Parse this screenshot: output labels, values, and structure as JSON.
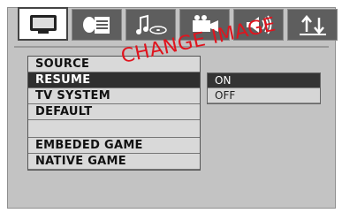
{
  "tabs": [
    {
      "icon": "tv-monitor-icon",
      "active": true
    },
    {
      "icon": "speaker-document-icon",
      "active": false
    },
    {
      "icon": "music-disc-icon",
      "active": false
    },
    {
      "icon": "video-camera-icon",
      "active": false
    },
    {
      "icon": "speaker-volume-icon",
      "active": false
    },
    {
      "icon": "up-down-arrows-icon",
      "active": false
    }
  ],
  "menu": {
    "items": [
      {
        "label": "SOURCE"
      },
      {
        "label": "RESUME",
        "selected": true
      },
      {
        "label": "TV SYSTEM"
      },
      {
        "label": "DEFAULT"
      },
      {
        "label": ""
      },
      {
        "label": "EMBEDED GAME"
      },
      {
        "label": "NATIVE GAME"
      }
    ]
  },
  "submenu": {
    "options": [
      {
        "label": "ON",
        "selected": true
      },
      {
        "label": "OFF"
      }
    ]
  },
  "watermark": "CHANGE IMAGE",
  "colors": {
    "panel": "#c3c3c3",
    "selected": "#2f2f2f",
    "watermark": "#e0141e"
  }
}
